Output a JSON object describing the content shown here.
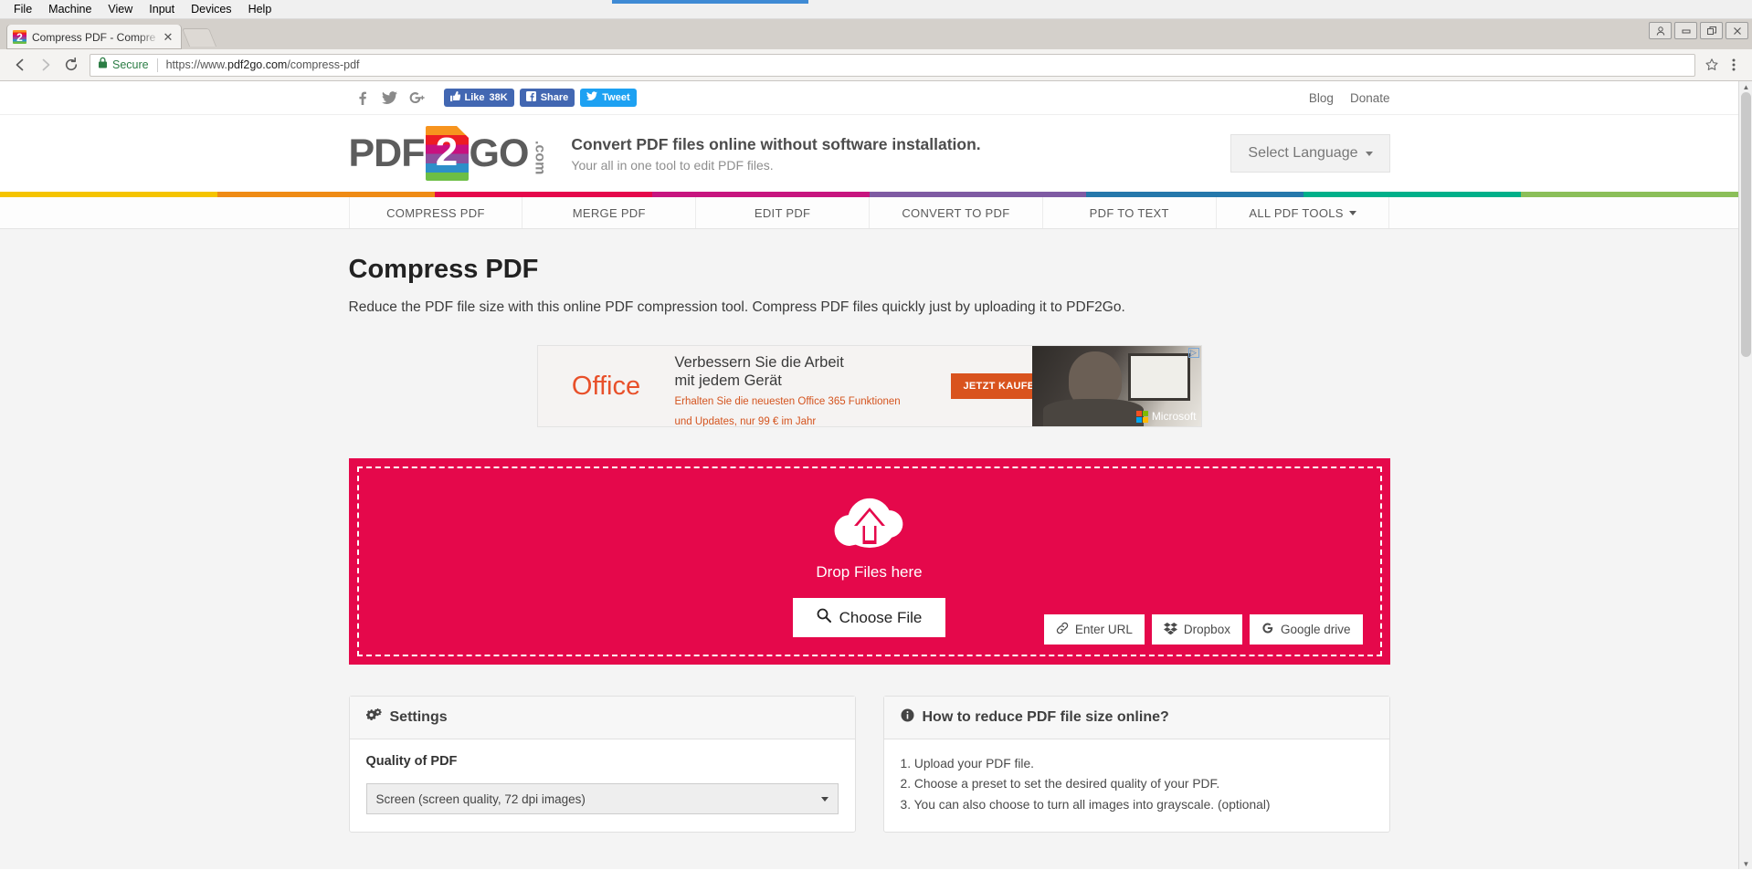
{
  "vbox_menu": [
    "File",
    "Machine",
    "View",
    "Input",
    "Devices",
    "Help"
  ],
  "browser": {
    "tab_title": "Compress PDF - Compre",
    "tab_close": "✕",
    "secure_label": "Secure",
    "url_scheme": "https://www.",
    "url_domain": "pdf2go.com",
    "url_path": "/compress-pdf",
    "back_icon": "back-arrow-icon",
    "forward_icon": "forward-arrow-icon",
    "reload_icon": "reload-icon",
    "star_icon": "bookmark-star-icon",
    "menu_icon": "chrome-menu-icon"
  },
  "utility": {
    "social_icons": [
      "facebook-icon",
      "twitter-icon",
      "google-plus-icon"
    ],
    "facebook_like": "Like",
    "facebook_like_count": "38K",
    "facebook_share": "Share",
    "twitter_tweet": "Tweet",
    "links": [
      "Blog",
      "Donate"
    ]
  },
  "masthead": {
    "logo_pdf": "PDF",
    "logo_two": "2",
    "logo_go": "GO",
    "logo_com": ".com",
    "headline": "Convert PDF files online without software installation.",
    "subline": "Your all in one tool to edit PDF files.",
    "language_button": "Select Language"
  },
  "colorbar": [
    "#f5c400",
    "#ef8b15",
    "#e5084b",
    "#c7157f",
    "#7f5ba3",
    "#2578ab",
    "#00b08a",
    "#8bbf59"
  ],
  "nav": [
    {
      "label": "COMPRESS PDF",
      "has_caret": false
    },
    {
      "label": "MERGE PDF",
      "has_caret": false
    },
    {
      "label": "EDIT PDF",
      "has_caret": false
    },
    {
      "label": "CONVERT TO PDF",
      "has_caret": false
    },
    {
      "label": "PDF TO TEXT",
      "has_caret": false
    },
    {
      "label": "ALL PDF TOOLS",
      "has_caret": true
    }
  ],
  "page": {
    "title": "Compress PDF",
    "description": "Reduce the PDF file size with this online PDF compression tool. Compress PDF files quickly just by uploading it to PDF2Go."
  },
  "ad": {
    "brand": "Office",
    "headline_line1": "Verbessern Sie die Arbeit",
    "headline_line2": "mit jedem Gerät",
    "sub_line1": "Erhalten Sie die neuesten Office 365 Funktionen",
    "sub_line2": "und Updates, nur 99 € im Jahr",
    "cta": "JETZT KAUFEN",
    "advertiser": "Microsoft",
    "adchoices": "▷"
  },
  "dropzone": {
    "cloud_icon": "cloud-upload-icon",
    "drop_label": "Drop Files here",
    "choose_file": "Choose File",
    "choose_file_icon": "search-icon",
    "sources": [
      {
        "label": "Enter URL",
        "icon": "link-icon"
      },
      {
        "label": "Dropbox",
        "icon": "dropbox-icon"
      },
      {
        "label": "Google drive",
        "icon": "google-drive-icon"
      }
    ]
  },
  "settings_panel": {
    "title": "Settings",
    "icon": "gears-icon",
    "field_label": "Quality of PDF",
    "selected_option": "Screen (screen quality, 72 dpi images)"
  },
  "howto_panel": {
    "title": "How to reduce PDF file size online?",
    "icon": "info-icon",
    "steps": [
      "Upload your PDF file.",
      "Choose a preset to set the desired quality of your PDF.",
      "You can also choose to turn all images into grayscale. (optional)"
    ]
  }
}
